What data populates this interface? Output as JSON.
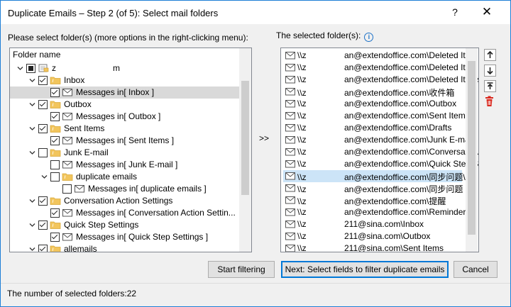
{
  "window": {
    "title": "Duplicate Emails – Step 2 (of 5): Select mail folders",
    "help": "?",
    "close": "✕"
  },
  "left_panel": {
    "label": "Please select folder(s) (more options in the right-clicking menu):",
    "header": "Folder name",
    "rows": [
      {
        "text": "z                        m",
        "level": 0,
        "twisty": "open",
        "check": "partial",
        "icon": "account-icon"
      },
      {
        "text": "Inbox",
        "level": 1,
        "twisty": "open",
        "check": "checked",
        "icon": "folder-icon"
      },
      {
        "text": "Messages in[ Inbox ]",
        "level": 2,
        "twisty": "none",
        "check": "checked",
        "icon": "envelope-icon",
        "selected": true
      },
      {
        "text": "Outbox",
        "level": 1,
        "twisty": "open",
        "check": "checked",
        "icon": "folder-icon"
      },
      {
        "text": "Messages in[ Outbox ]",
        "level": 2,
        "twisty": "none",
        "check": "checked",
        "icon": "envelope-icon"
      },
      {
        "text": "Sent Items",
        "level": 1,
        "twisty": "open",
        "check": "checked",
        "icon": "folder-icon"
      },
      {
        "text": "Messages in[ Sent Items ]",
        "level": 2,
        "twisty": "none",
        "check": "checked",
        "icon": "envelope-icon"
      },
      {
        "text": "Junk E-mail",
        "level": 1,
        "twisty": "open",
        "check": "unchecked",
        "icon": "folder-icon"
      },
      {
        "text": "Messages in[ Junk E-mail ]",
        "level": 2,
        "twisty": "none",
        "check": "unchecked",
        "icon": "envelope-icon"
      },
      {
        "text": "duplicate emails",
        "level": 2,
        "twisty": "open",
        "check": "unchecked",
        "icon": "folder-icon"
      },
      {
        "text": "Messages in[ duplicate emails ]",
        "level": 3,
        "twisty": "none",
        "check": "unchecked",
        "icon": "envelope-icon"
      },
      {
        "text": "Conversation Action Settings",
        "level": 1,
        "twisty": "open",
        "check": "checked",
        "icon": "folder-icon"
      },
      {
        "text": "Messages in[ Conversation Action Settin...",
        "level": 2,
        "twisty": "none",
        "check": "checked",
        "icon": "envelope-icon"
      },
      {
        "text": "Quick Step Settings",
        "level": 1,
        "twisty": "open",
        "check": "checked",
        "icon": "folder-icon"
      },
      {
        "text": "Messages in[ Quick Step Settings ]",
        "level": 2,
        "twisty": "none",
        "check": "checked",
        "icon": "envelope-icon"
      },
      {
        "text": "allemails",
        "level": 1,
        "twisty": "open",
        "check": "checked",
        "icon": "folder-icon"
      }
    ]
  },
  "middle": {
    "arrow": ">>"
  },
  "right_panel": {
    "label": "The selected folder(s):",
    "items": [
      "\\\\z                an@extendoffice.com\\Deleted Ite...",
      "\\\\z                an@extendoffice.com\\Deleted Ite...",
      "\\\\z                an@extendoffice.com\\Deleted Items",
      "\\\\z                an@extendoffice.com\\收件箱",
      "\\\\z                an@extendoffice.com\\Outbox",
      "\\\\z                an@extendoffice.com\\Sent Items",
      "\\\\z                an@extendoffice.com\\Drafts",
      "\\\\z                an@extendoffice.com\\Junk E-mail",
      "\\\\z                an@extendoffice.com\\Conversatio...",
      "\\\\z                an@extendoffice.com\\Quick Step S...",
      "\\\\z                an@extendoffice.com\\同步问题\\...",
      "\\\\z                an@extendoffice.com\\同步问题",
      "\\\\z                an@extendoffice.com\\提醒",
      "\\\\z                an@extendoffice.com\\Reminders",
      "\\\\z                211@sina.com\\Inbox",
      "\\\\z                211@sina.com\\Outbox",
      "\\\\z                211@sina.com\\Sent Items"
    ],
    "selected_index": 10
  },
  "side_buttons": [
    "move-up-icon",
    "move-down-icon",
    "move-top-icon",
    "delete-icon"
  ],
  "buttons": {
    "start": "Start filtering",
    "next": "Next: Select fields to filter duplicate emails",
    "cancel": "Cancel"
  },
  "status": {
    "text": "The number of selected folders:22"
  },
  "colors": {
    "accent": "#0078d7",
    "selection": "#cce4f7",
    "tree_selection": "#d9d9d9",
    "folder": "#f2c55c",
    "delete": "#d9261c"
  }
}
